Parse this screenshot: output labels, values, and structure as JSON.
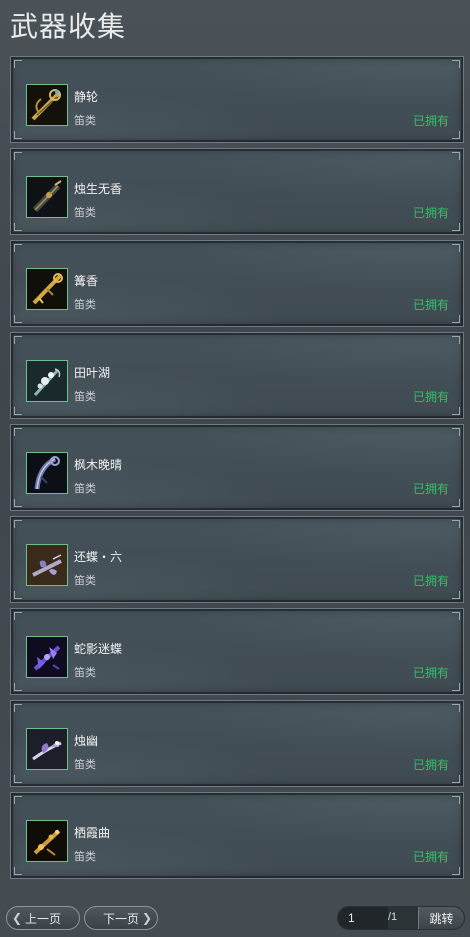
{
  "title": "武器收集",
  "items": [
    {
      "name": "静轮",
      "category": "笛类",
      "status": "已拥有",
      "icon": "flute-golden-ornate-icon"
    },
    {
      "name": "烛生无香",
      "category": "笛类",
      "status": "已拥有",
      "icon": "flute-dark-icon"
    },
    {
      "name": "篝香",
      "category": "笛类",
      "status": "已拥有",
      "icon": "flute-gold-icon"
    },
    {
      "name": "田叶湖",
      "category": "笛类",
      "status": "已拥有",
      "icon": "flute-flower-icon"
    },
    {
      "name": "枫木晚晴",
      "category": "笛类",
      "status": "已拥有",
      "icon": "flute-purple-icon"
    },
    {
      "name": "还蝶・六",
      "category": "笛类",
      "status": "已拥有",
      "icon": "flute-butterfly-icon"
    },
    {
      "name": "蛇影迷蝶",
      "category": "笛类",
      "status": "已拥有",
      "icon": "flute-violet-icon"
    },
    {
      "name": "烛幽",
      "category": "笛类",
      "status": "已拥有",
      "icon": "flute-lilac-icon"
    },
    {
      "name": "栖霞曲",
      "category": "笛类",
      "status": "已拥有",
      "icon": "flute-amber-icon"
    }
  ],
  "pagination": {
    "prev_label": "上一页",
    "next_label": "下一页",
    "current_page": "1",
    "total_pages": "/1",
    "jump_label": "跳转"
  },
  "colors": {
    "owned_status": "#2fc16a",
    "thumb_border": "#6fbf8d"
  }
}
